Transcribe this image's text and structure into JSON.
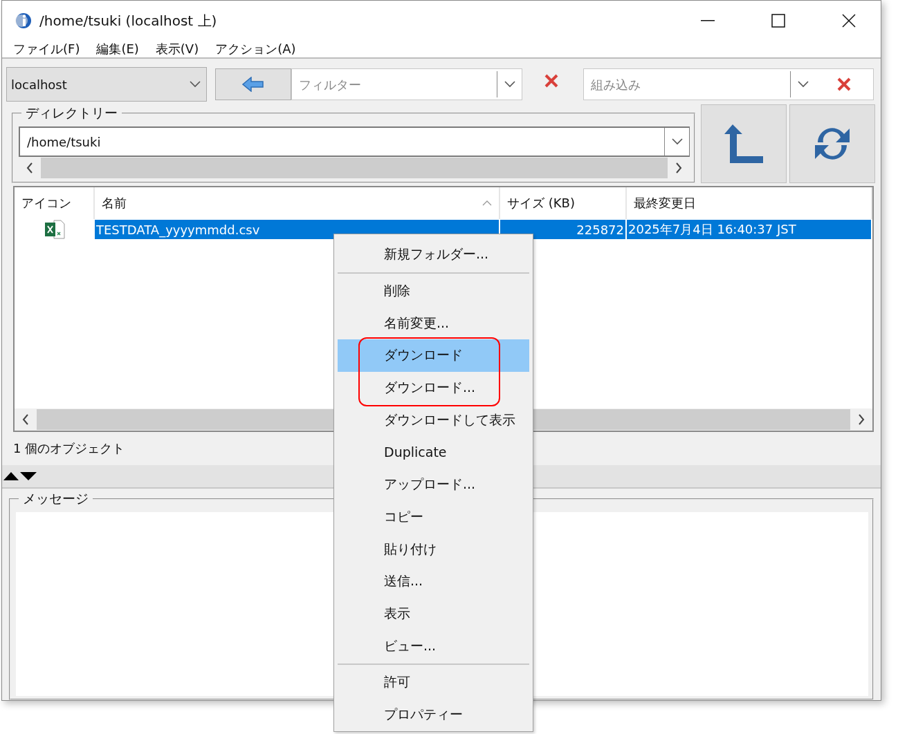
{
  "window": {
    "title": "/home/tsuki (localhost 上)"
  },
  "menu": [
    {
      "label": "ファイル(F)"
    },
    {
      "label": "編集(E)"
    },
    {
      "label": "表示(V)"
    },
    {
      "label": "アクション(A)"
    }
  ],
  "toolbar": {
    "host": "localhost",
    "filter": {
      "placeholder": "フィルター"
    },
    "preset": {
      "placeholder": "組み込み"
    }
  },
  "directory": {
    "label": "ディレクトリー",
    "path": "/home/tsuki"
  },
  "table": {
    "columns": [
      {
        "label": "アイコン",
        "sorted": false
      },
      {
        "label": "名前",
        "sorted": true
      },
      {
        "label": "サイズ (KB)",
        "sorted": false
      },
      {
        "label": "最終変更日",
        "sorted": false
      }
    ],
    "rows": [
      {
        "name": "TESTDATA_yyyymmdd.csv",
        "size": "225872",
        "modified": "2025年7月4日 16:40:37 JST",
        "selected": true
      }
    ]
  },
  "status": "1 個のオブジェクト",
  "messages": {
    "label": "メッセージ"
  },
  "context_menu": {
    "items": [
      {
        "kind": "item",
        "label": "新規フォルダー...",
        "selected": false,
        "outlined": false
      },
      {
        "kind": "separator"
      },
      {
        "kind": "item",
        "label": "削除",
        "selected": false,
        "outlined": false
      },
      {
        "kind": "item",
        "label": "名前変更...",
        "selected": false,
        "outlined": false
      },
      {
        "kind": "item",
        "label": "ダウンロード",
        "selected": true,
        "outlined": true
      },
      {
        "kind": "item",
        "label": "ダウンロード...",
        "selected": false,
        "outlined": true
      },
      {
        "kind": "item",
        "label": "ダウンロードして表示",
        "selected": false,
        "outlined": false
      },
      {
        "kind": "item",
        "label": "Duplicate",
        "selected": false,
        "outlined": false
      },
      {
        "kind": "item",
        "label": "アップロード...",
        "selected": false,
        "outlined": false
      },
      {
        "kind": "item",
        "label": "コピー",
        "selected": false,
        "outlined": false
      },
      {
        "kind": "item",
        "label": "貼り付け",
        "selected": false,
        "outlined": false
      },
      {
        "kind": "item",
        "label": "送信...",
        "selected": false,
        "outlined": false
      },
      {
        "kind": "item",
        "label": "表示",
        "selected": false,
        "outlined": false
      },
      {
        "kind": "item",
        "label": "ビュー...",
        "selected": false,
        "outlined": false
      },
      {
        "kind": "separator"
      },
      {
        "kind": "item",
        "label": "許可",
        "selected": false,
        "outlined": false
      },
      {
        "kind": "item",
        "label": "プロパティー",
        "selected": false,
        "outlined": false
      }
    ]
  }
}
